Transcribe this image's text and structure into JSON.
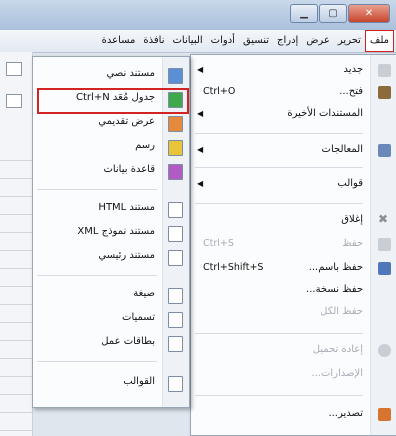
{
  "menubar": {
    "items": [
      "ملف",
      "تحرير",
      "عرض",
      "إدراج",
      "تنسيق",
      "أدوات",
      "البيانات",
      "نافذة",
      "مساعدة"
    ]
  },
  "main_menu": {
    "items": [
      {
        "label": "جديد",
        "shortcut": "",
        "submenu": true,
        "enabled": true,
        "icon": "new-doc-icon"
      },
      {
        "label": "فتح...",
        "shortcut": "Ctrl+O",
        "submenu": false,
        "enabled": true,
        "icon": "folder-open-icon"
      },
      {
        "label": "المستندات الأخيرة",
        "shortcut": "",
        "submenu": true,
        "enabled": true,
        "icon": ""
      },
      {
        "label": "المعالجات",
        "shortcut": "",
        "submenu": true,
        "enabled": true,
        "icon": "wizard-icon"
      },
      {
        "label": "قوالب",
        "shortcut": "",
        "submenu": true,
        "enabled": true,
        "icon": ""
      },
      {
        "label": "إغلاق",
        "shortcut": "",
        "submenu": false,
        "enabled": true,
        "icon": "close-x-icon"
      },
      {
        "label": "حفظ",
        "shortcut": "Ctrl+S",
        "submenu": false,
        "enabled": false,
        "icon": "save-icon"
      },
      {
        "label": "حفظ باسم...",
        "shortcut": "Ctrl+Shift+S",
        "submenu": false,
        "enabled": true,
        "icon": "save-as-icon"
      },
      {
        "label": "حفظ نسخة...",
        "shortcut": "",
        "submenu": false,
        "enabled": true,
        "icon": ""
      },
      {
        "label": "حفظ الكل",
        "shortcut": "",
        "submenu": false,
        "enabled": false,
        "icon": ""
      },
      {
        "label": "إعادة تحميل",
        "shortcut": "",
        "submenu": false,
        "enabled": false,
        "icon": "reload-icon"
      },
      {
        "label": "الإصدارات...",
        "shortcut": "",
        "submenu": false,
        "enabled": false,
        "icon": ""
      },
      {
        "label": "تصدير...",
        "shortcut": "",
        "submenu": false,
        "enabled": true,
        "icon": "export-icon"
      }
    ]
  },
  "submenu_new": {
    "items": [
      {
        "label": "مستند نصي",
        "shortcut": "",
        "icon": "text-document-icon"
      },
      {
        "label": "جدول مُعَد Ctrl+N",
        "shortcut": "",
        "icon": "spreadsheet-icon"
      },
      {
        "label": "عرض تقديمي",
        "shortcut": "",
        "icon": "presentation-icon"
      },
      {
        "label": "رسم",
        "shortcut": "",
        "icon": "drawing-icon"
      },
      {
        "label": "قاعدة بيانات",
        "shortcut": "",
        "icon": "database-icon"
      },
      {
        "label": "مستند HTML",
        "shortcut": "",
        "icon": "html-document-icon"
      },
      {
        "label": "مستند نموذج XML",
        "shortcut": "",
        "icon": "xml-form-icon"
      },
      {
        "label": "مستند رئيسي",
        "shortcut": "",
        "icon": "master-document-icon"
      },
      {
        "label": "صيغة",
        "shortcut": "",
        "icon": "formula-icon"
      },
      {
        "label": "تسميات",
        "shortcut": "",
        "icon": "labels-icon"
      },
      {
        "label": "بطاقات عمل",
        "shortcut": "",
        "icon": "business-cards-icon"
      },
      {
        "label": "القوالب",
        "shortcut": "",
        "icon": "templates-icon"
      }
    ]
  }
}
